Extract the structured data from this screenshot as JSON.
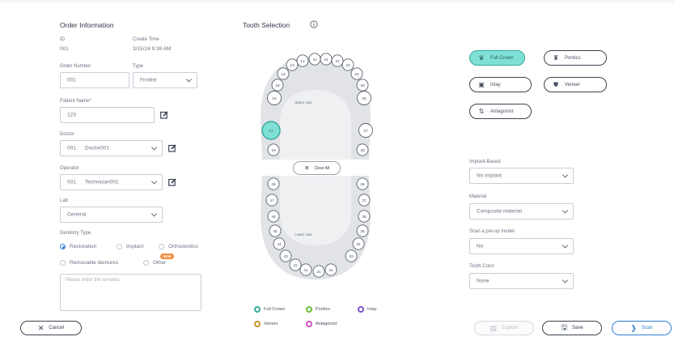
{
  "order": {
    "title": "Order Information",
    "id_label": "ID",
    "id_value": "001",
    "create_time_label": "Create Time",
    "create_time_value": "3/15/24 9:38 AM",
    "order_number_label": "Order Number",
    "order_number_value": "001",
    "type_label": "Type",
    "type_value": "Firstlist",
    "patient_label": "Patient Name*",
    "patient_value": "123",
    "doctor_label": "Doctor",
    "doctor_code": "001",
    "doctor_name": "Doctor001",
    "operator_label": "Operator",
    "operator_code": "001",
    "operator_name": "Technician001",
    "lab_label": "Lab",
    "lab_value": "General",
    "dentistry_label": "Dentistry Type",
    "dentistry_options": [
      "Restoration",
      "Implant",
      "Orthodontics",
      "Removable dentures",
      "Other"
    ],
    "dentistry_selected": "Restoration",
    "new_badge": "NEW",
    "remarks_placeholder": "Please enter the remarks"
  },
  "tooth_selection": {
    "title": "Tooth Selection",
    "info_icon": "info-icon",
    "upper_label": "Upper Jaw",
    "lower_label": "Lower Jaw",
    "clear_all": "Clear All",
    "selected_tooth": "17",
    "upper_teeth_left": [
      "13",
      "14",
      "15",
      "16",
      "17",
      "18"
    ],
    "upper_teeth_top": [
      "12",
      "11",
      "21",
      "22"
    ],
    "upper_teeth_right": [
      "23",
      "24",
      "25",
      "26",
      "27",
      "28"
    ],
    "lower_teeth_left": [
      "48",
      "47",
      "46",
      "45",
      "44",
      "43"
    ],
    "lower_teeth_bottom": [
      "42",
      "41",
      "31",
      "32"
    ],
    "lower_teeth_right": [
      "38",
      "37",
      "36",
      "35",
      "34",
      "33"
    ],
    "legend": [
      {
        "label": "Full Crown",
        "color": "#3aa89b"
      },
      {
        "label": "Pontics",
        "color": "#6bbf3a"
      },
      {
        "label": "Inlay",
        "color": "#7a55c9"
      },
      {
        "label": "Veneer",
        "color": "#c9962d"
      },
      {
        "label": "Antagonist",
        "color": "#c94fc2"
      }
    ]
  },
  "restoration_types": {
    "full_crown": "Full Crown",
    "pontics": "Pontics",
    "inlay": "Inlay",
    "veneer": "Veneer",
    "antagonist": "Antagonist"
  },
  "settings": {
    "implant_label": "Implant-Based",
    "implant_value": "No implant",
    "material_label": "Material",
    "material_value": "Composite material",
    "preop_label": "Scan a pre-op model",
    "preop_value": "No",
    "color_label": "Tooth Color",
    "color_value": "None"
  },
  "actions": {
    "cancel": "Cancel",
    "explore": "Explore",
    "save": "Save",
    "scan": "Scan"
  },
  "colors": {
    "accent": "#2d7fd3",
    "selected_fill": "#7fe0d6",
    "tooth_fill": "#e3e5e8",
    "new_badge": "#f08a3b"
  }
}
